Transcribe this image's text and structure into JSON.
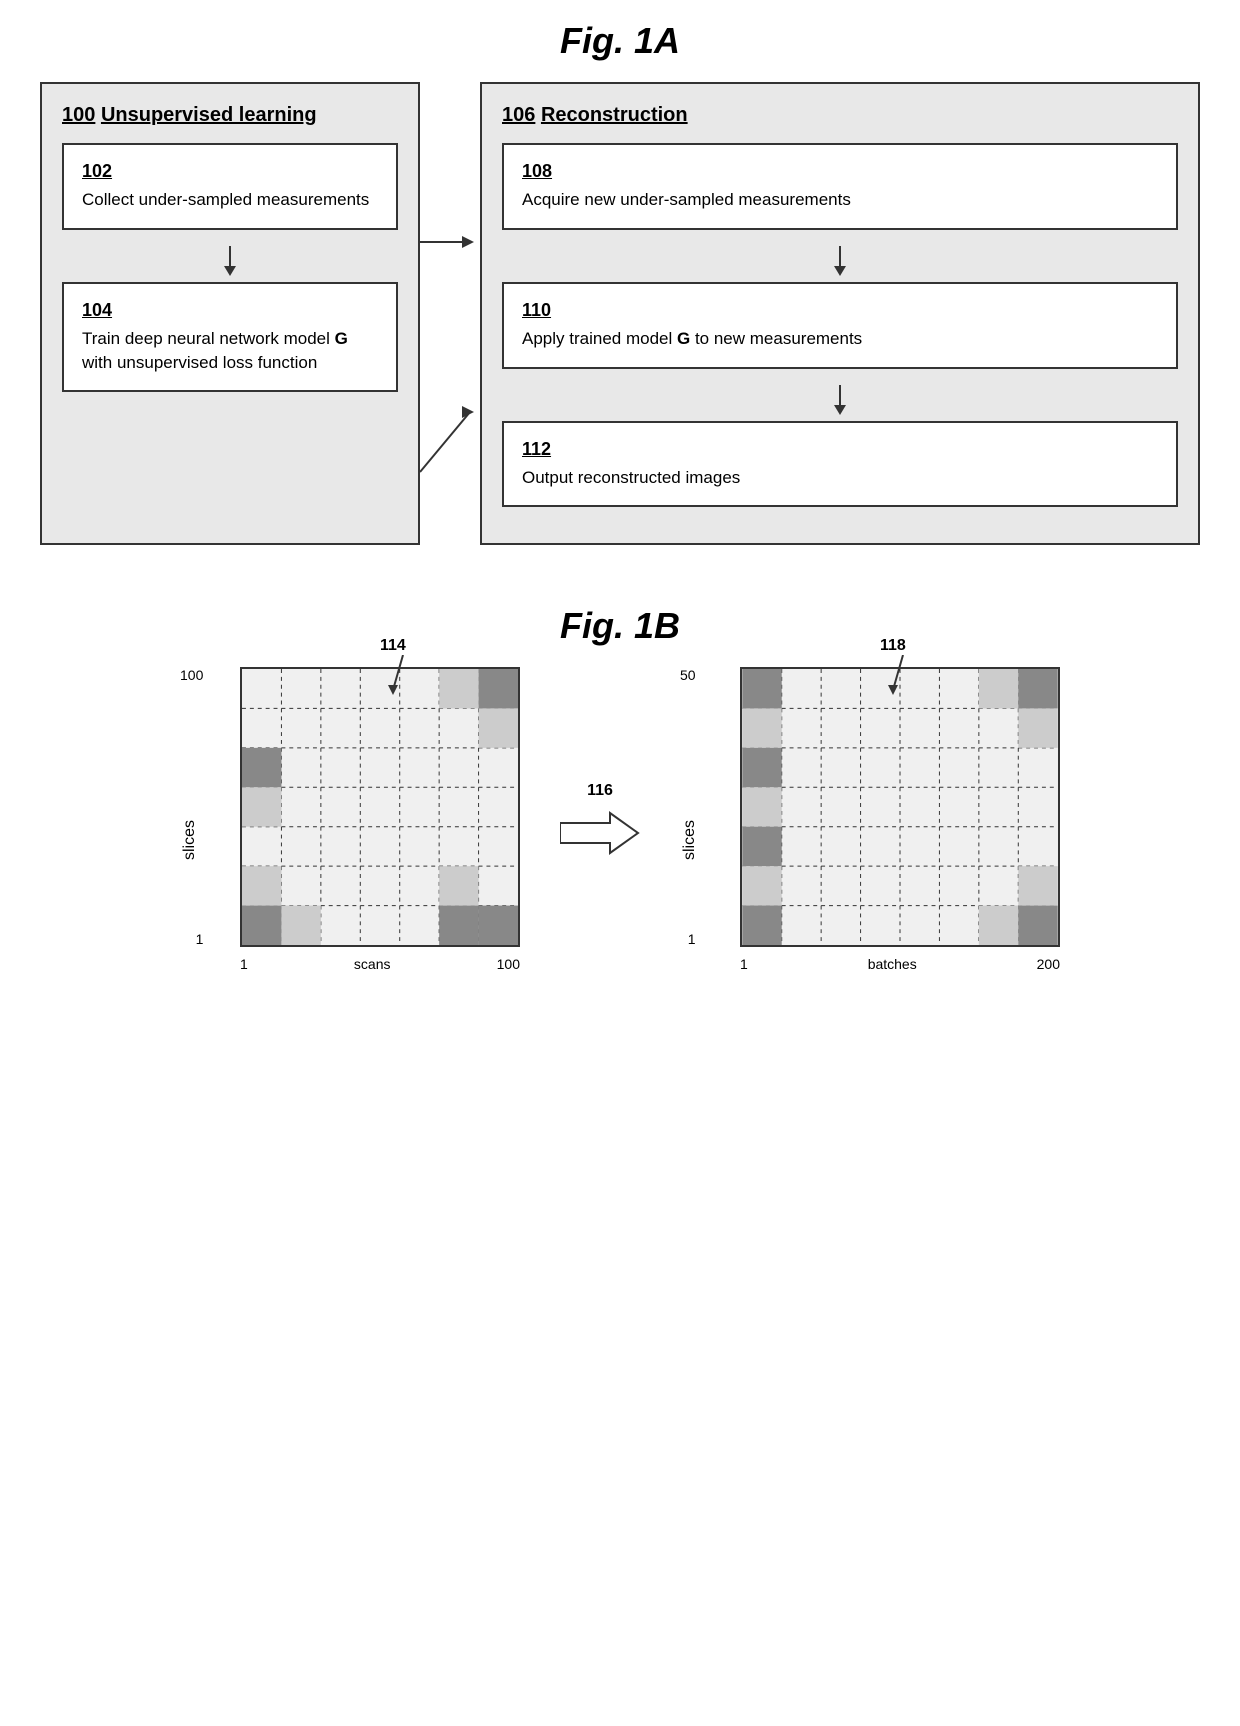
{
  "fig1a": {
    "title": "Fig. 1A",
    "left": {
      "id": "100",
      "label": "Unsupervised learning",
      "box1": {
        "id": "102",
        "text": "Collect under-sampled measurements"
      },
      "box2": {
        "id": "104",
        "text": "Train deep neural network model G with unsupervised loss function"
      }
    },
    "right": {
      "id": "106",
      "label": "Reconstruction",
      "box1": {
        "id": "108",
        "text": "Acquire new under-sampled measurements"
      },
      "box2": {
        "id": "110",
        "text": "Apply trained model G to new measurements"
      },
      "box3": {
        "id": "112",
        "text": "Output reconstructed images"
      }
    }
  },
  "fig1b": {
    "title": "Fig. 1B",
    "left_diagram": {
      "id": "114",
      "top_value": "100",
      "bottom_value": "1",
      "left_label": "slices",
      "bottom_label": "scans",
      "x_left": "1",
      "x_right": "100"
    },
    "arrow": {
      "id": "116"
    },
    "right_diagram": {
      "id": "118",
      "top_value": "50",
      "bottom_value": "1",
      "left_label": "slices",
      "bottom_label": "batches",
      "x_left": "1",
      "x_right": "200"
    }
  }
}
